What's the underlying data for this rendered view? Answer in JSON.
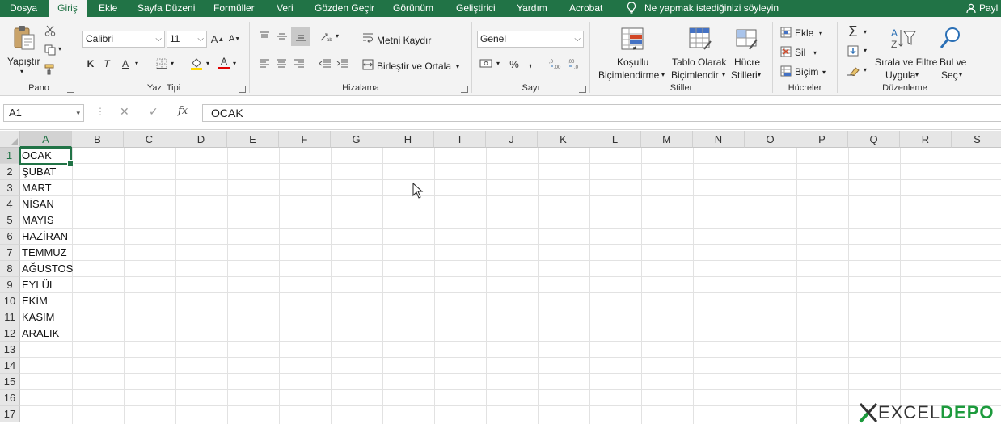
{
  "tabs": [
    {
      "label": "Dosya",
      "active": false
    },
    {
      "label": "Giriş",
      "active": true
    },
    {
      "label": "Ekle",
      "active": false
    },
    {
      "label": "Sayfa Düzeni",
      "active": false
    },
    {
      "label": "Formüller",
      "active": false
    },
    {
      "label": "Veri",
      "active": false
    },
    {
      "label": "Gözden Geçir",
      "active": false
    },
    {
      "label": "Görünüm",
      "active": false
    },
    {
      "label": "Geliştirici",
      "active": false
    },
    {
      "label": "Yardım",
      "active": false
    },
    {
      "label": "Acrobat",
      "active": false
    }
  ],
  "tell_me": "Ne yapmak istediğinizi söyleyin",
  "share": "Payl",
  "ribbon": {
    "clipboard": {
      "paste": "Yapıştır",
      "group": "Pano"
    },
    "font": {
      "name": "Calibri",
      "size": "11",
      "bold": "K",
      "italic": "T",
      "underline": "A",
      "font_color": "A",
      "grow": "A",
      "shrink": "A",
      "group": "Yazı Tipi"
    },
    "alignment": {
      "wrap": "Metni Kaydır",
      "merge": "Birleştir ve Ortala",
      "group": "Hizalama"
    },
    "number": {
      "format": "Genel",
      "percent": "%",
      "comma": ",",
      "group": "Sayı"
    },
    "styles": {
      "conditional_1": "Koşullu",
      "conditional_2": "Biçimlendirme",
      "table_1": "Tablo Olarak",
      "table_2": "Biçimlendir",
      "cell_1": "Hücre",
      "cell_2": "Stilleri",
      "group": "Stiller"
    },
    "cells": {
      "insert": "Ekle",
      "delete": "Sil",
      "format": "Biçim",
      "group": "Hücreler"
    },
    "editing": {
      "sort_1": "Sırala ve Filtre",
      "sort_2": "Uygula",
      "find_1": "Bul ve",
      "find_2": "Seç",
      "group": "Düzenleme"
    }
  },
  "formula_bar": {
    "name_box": "A1",
    "fx": "fx",
    "value": "OCAK"
  },
  "columns": [
    "A",
    "B",
    "C",
    "D",
    "E",
    "F",
    "G",
    "H",
    "I",
    "J",
    "K",
    "L",
    "M",
    "N",
    "O",
    "P",
    "Q",
    "R",
    "S"
  ],
  "rows": [
    "1",
    "2",
    "3",
    "4",
    "5",
    "6",
    "7",
    "8",
    "9",
    "10",
    "11",
    "12",
    "13",
    "14",
    "15",
    "16",
    "17"
  ],
  "cells_a": [
    "OCAK",
    "ŞUBAT",
    "MART",
    "NİSAN",
    "MAYIS",
    "HAZİRAN",
    "TEMMUZ",
    "AĞUSTOS",
    "EYLÜL",
    "EKİM",
    "KASIM",
    "ARALIK"
  ],
  "watermark": {
    "part1": "EXCEL",
    "part2": "DEPO"
  },
  "colors": {
    "accent": "#217346",
    "ribbon_bg": "#f3f3f3"
  }
}
